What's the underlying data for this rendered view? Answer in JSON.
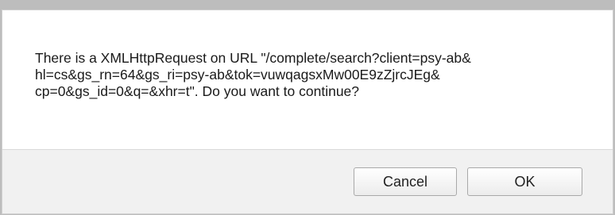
{
  "dialog": {
    "message": "There is a XMLHttpRequest on URL \"/complete/search?client=psy-ab&\nhl=cs&gs_rn=64&gs_ri=psy-ab&tok=vuwqagsxMw00E9zZjrcJEg&\ncp=0&gs_id=0&q=&xhr=t\". Do you want to continue?",
    "cancel_label": "Cancel",
    "ok_label": "OK"
  }
}
